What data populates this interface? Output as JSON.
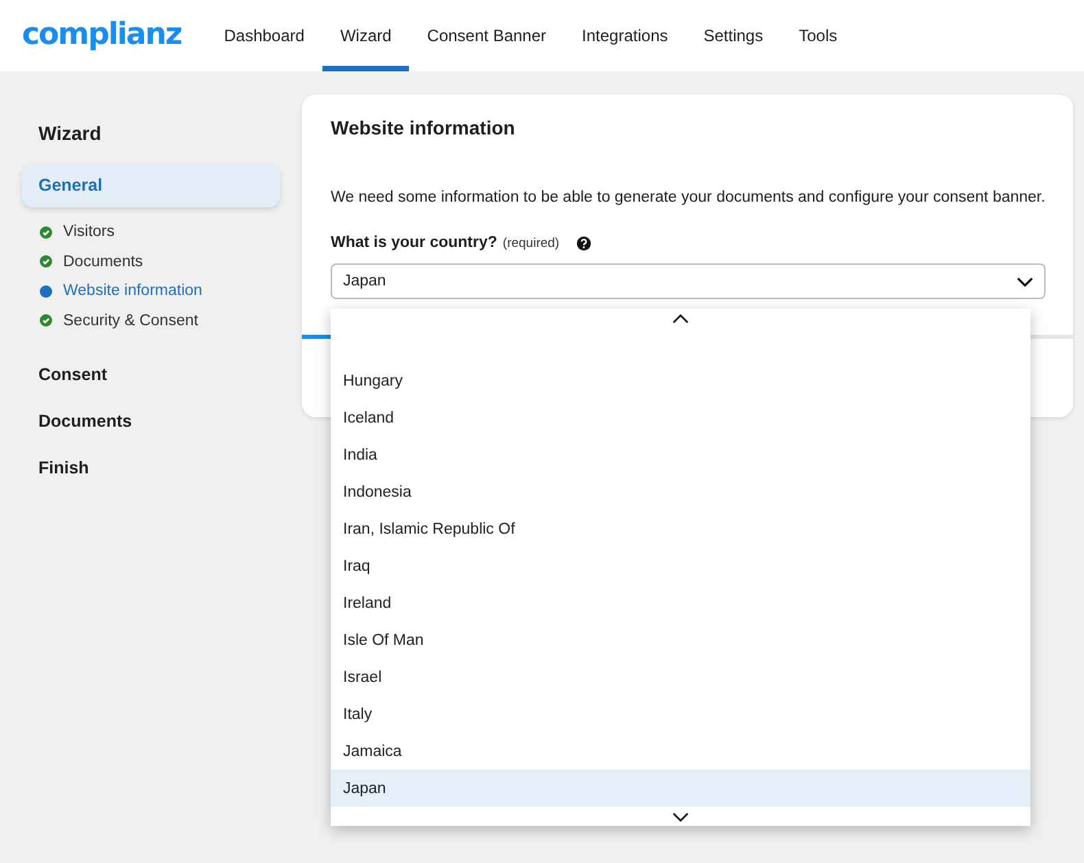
{
  "header": {
    "logo": "complianz",
    "tabs": [
      {
        "label": "Dashboard",
        "selected": false
      },
      {
        "label": "Wizard",
        "selected": true
      },
      {
        "label": "Consent Banner",
        "selected": false
      },
      {
        "label": "Integrations",
        "selected": false
      },
      {
        "label": "Settings",
        "selected": false
      },
      {
        "label": "Tools",
        "selected": false
      }
    ]
  },
  "sidebar": {
    "title": "Wizard",
    "sections": [
      {
        "label": "General",
        "selected": true,
        "steps": [
          {
            "label": "Visitors",
            "kind": "done"
          },
          {
            "label": "Documents",
            "kind": "done"
          },
          {
            "label": "Website information",
            "kind": "current"
          },
          {
            "label": "Security & Consent",
            "kind": "done"
          }
        ]
      },
      {
        "label": "Consent",
        "selected": false
      },
      {
        "label": "Documents",
        "selected": false
      },
      {
        "label": "Finish",
        "selected": false
      }
    ]
  },
  "card": {
    "title": "Website information",
    "description": "We need some information to be able to generate your documents and configure your consent banner.",
    "progress": {
      "level": 0.04
    },
    "field": {
      "label": "What is your country?",
      "note": "(required)",
      "value": "Japan"
    },
    "dropdown": {
      "options": [
        {
          "label": "Hungary",
          "selected": false
        },
        {
          "label": "Iceland",
          "selected": false
        },
        {
          "label": "India",
          "selected": false
        },
        {
          "label": "Indonesia",
          "selected": false
        },
        {
          "label": "Iran, Islamic Republic Of",
          "selected": false
        },
        {
          "label": "Iraq",
          "selected": false
        },
        {
          "label": "Ireland",
          "selected": false
        },
        {
          "label": "Isle Of Man",
          "selected": false
        },
        {
          "label": "Israel",
          "selected": false
        },
        {
          "label": "Italy",
          "selected": false
        },
        {
          "label": "Jamaica",
          "selected": false
        },
        {
          "label": "Japan",
          "selected": true
        }
      ]
    }
  }
}
